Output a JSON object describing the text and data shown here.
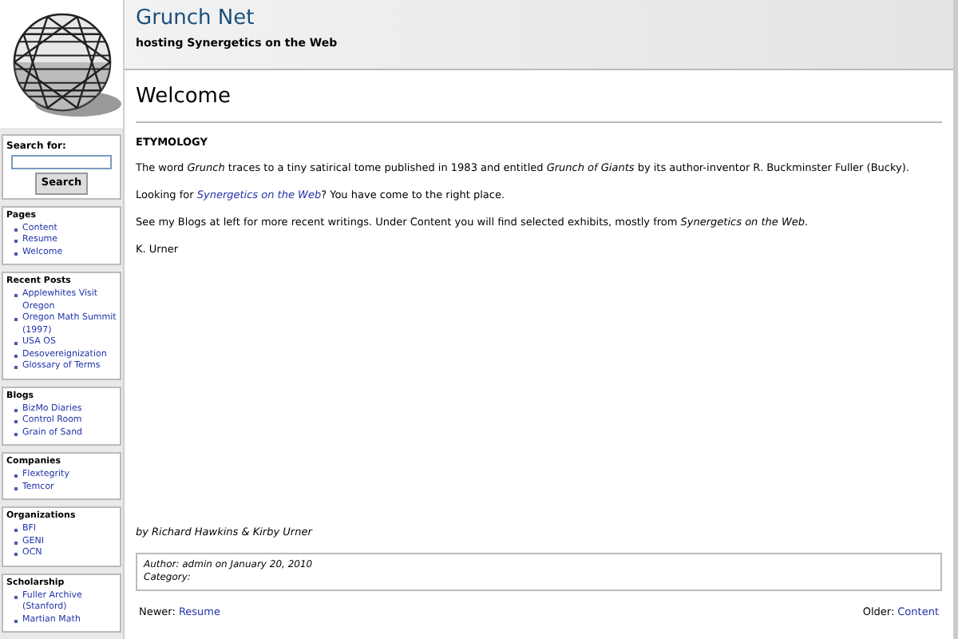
{
  "site": {
    "title": "Grunch Net",
    "tagline": "hosting Synergetics on the Web"
  },
  "search": {
    "label": "Search for:",
    "button": "Search"
  },
  "sidebar": [
    {
      "title": "Pages",
      "items": [
        "Content",
        "Resume",
        "Welcome"
      ]
    },
    {
      "title": "Recent Posts",
      "items": [
        "Applewhites Visit Oregon",
        "Oregon Math Summit (1997)",
        "USA OS",
        "Desovereignization",
        "Glossary of Terms"
      ]
    },
    {
      "title": "Blogs",
      "items": [
        "BizMo Diaries",
        "Control Room",
        "Grain of Sand"
      ]
    },
    {
      "title": "Companies",
      "items": [
        "Flextegrity",
        "Temcor"
      ]
    },
    {
      "title": "Organizations",
      "items": [
        "BFI",
        "GENI",
        "OCN"
      ]
    },
    {
      "title": "Scholarship",
      "items": [
        "Fuller Archive (Stanford)",
        "Martian Math"
      ]
    }
  ],
  "post": {
    "title": "Welcome",
    "heading": "ETYMOLOGY",
    "paragraphs": [
      {
        "kind": "text",
        "text": "The word *Grunch* traces to a tiny satirical tome published in 1983 and entitled *Grunch of Giants* by its author-inventor R. Buckminster Fuller (Bucky)."
      },
      {
        "kind": "link",
        "before": "Looking for ",
        "link": "Synergetics on the Web",
        "after": "?  You have come to the right place."
      },
      {
        "kind": "text",
        "text": "See my Blogs at left for more recent writings.  Under Content you will find selected exhibits, mostly from *Synergetics on the Web*."
      },
      {
        "kind": "text",
        "text": "K. Urner"
      }
    ],
    "byline": "by Richard Hawkins & Kirby Urner",
    "meta": [
      "Author: admin on January 20, 2010",
      "Category:"
    ],
    "nav": {
      "newer_label": "Newer:",
      "newer": "Resume",
      "older_label": "Older:",
      "older": "Content"
    }
  }
}
